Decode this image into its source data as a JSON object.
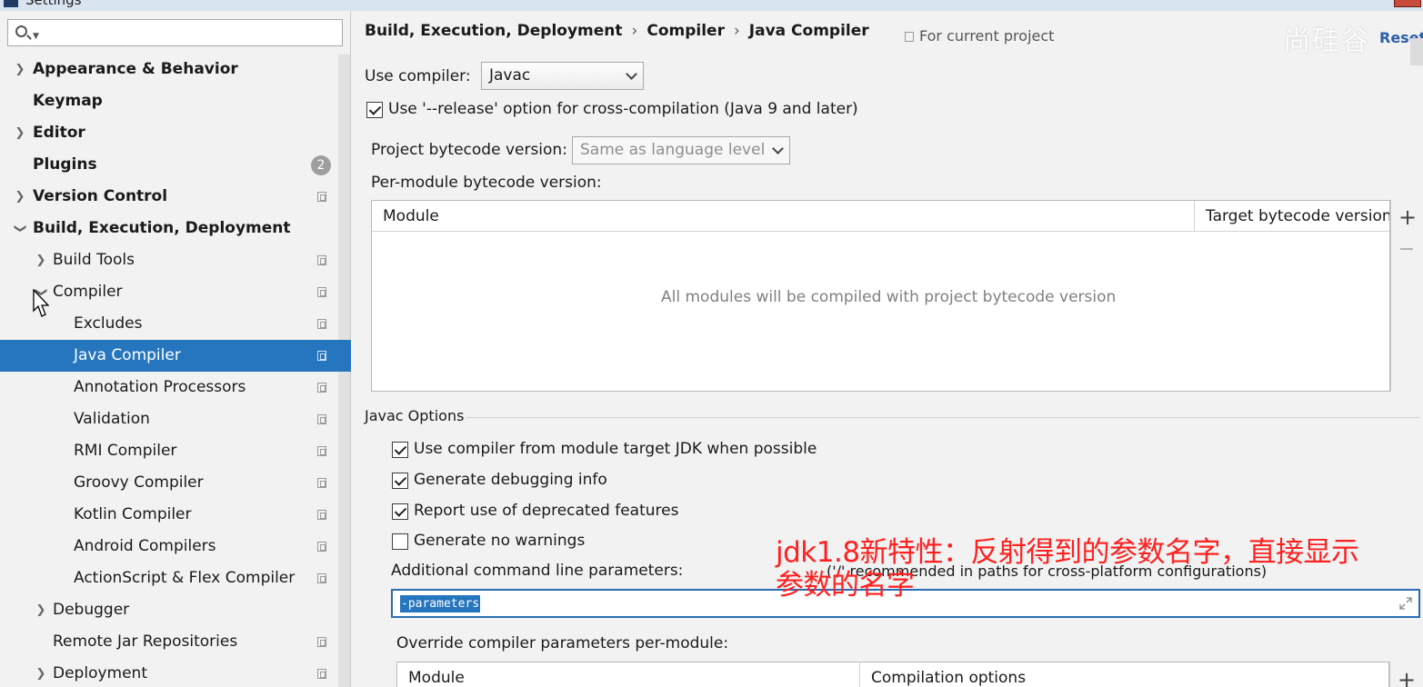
{
  "window": {
    "title": "Settings"
  },
  "search": {
    "placeholder": ""
  },
  "sidebar": {
    "items": [
      {
        "label": "Appearance & Behavior"
      },
      {
        "label": "Keymap"
      },
      {
        "label": "Editor"
      },
      {
        "label": "Plugins",
        "badge": "2"
      },
      {
        "label": "Version Control"
      },
      {
        "label": "Build, Execution, Deployment"
      },
      {
        "label": "Build Tools"
      },
      {
        "label": "Compiler"
      },
      {
        "label": "Excludes"
      },
      {
        "label": "Java Compiler"
      },
      {
        "label": "Annotation Processors"
      },
      {
        "label": "Validation"
      },
      {
        "label": "RMI Compiler"
      },
      {
        "label": "Groovy Compiler"
      },
      {
        "label": "Kotlin Compiler"
      },
      {
        "label": "Android Compilers"
      },
      {
        "label": "ActionScript & Flex Compiler"
      },
      {
        "label": "Debugger"
      },
      {
        "label": "Remote Jar Repositories"
      },
      {
        "label": "Deployment"
      }
    ]
  },
  "header": {
    "crumbs": [
      "Build, Execution, Deployment",
      "Compiler",
      "Java Compiler"
    ],
    "separator": "›",
    "for_project": "For current project",
    "reset": "Reset",
    "watermark": "尚硅谷"
  },
  "compiler": {
    "use_compiler_label": "Use compiler:",
    "use_compiler_value": "Javac",
    "release_option": "Use '--release' option for cross-compilation (Java 9 and later)",
    "bytecode_label": "Project bytecode version:",
    "bytecode_value": "Same as language level",
    "per_module_label": "Per-module bytecode version:",
    "table": {
      "col_module": "Module",
      "col_target": "Target bytecode version",
      "empty": "All modules will be compiled with project bytecode version"
    }
  },
  "javac": {
    "section": "Javac Options",
    "options": [
      {
        "label": "Use compiler from module target JDK when possible",
        "checked": true
      },
      {
        "label": "Generate debugging info",
        "checked": true
      },
      {
        "label": "Report use of deprecated features",
        "checked": true
      },
      {
        "label": "Generate no warnings",
        "checked": false
      }
    ],
    "additional_label": "Additional command line parameters:",
    "additional_hint": "('/' recommended in paths for cross-platform configurations)",
    "additional_value": "-parameters",
    "override_label": "Override compiler parameters per-module:",
    "override_table": {
      "col_module": "Module",
      "col_options": "Compilation options"
    }
  },
  "annotation": {
    "line1": "jdk1.8新特性：反射得到的参数名字，直接显示",
    "line2": "参数的名字"
  }
}
